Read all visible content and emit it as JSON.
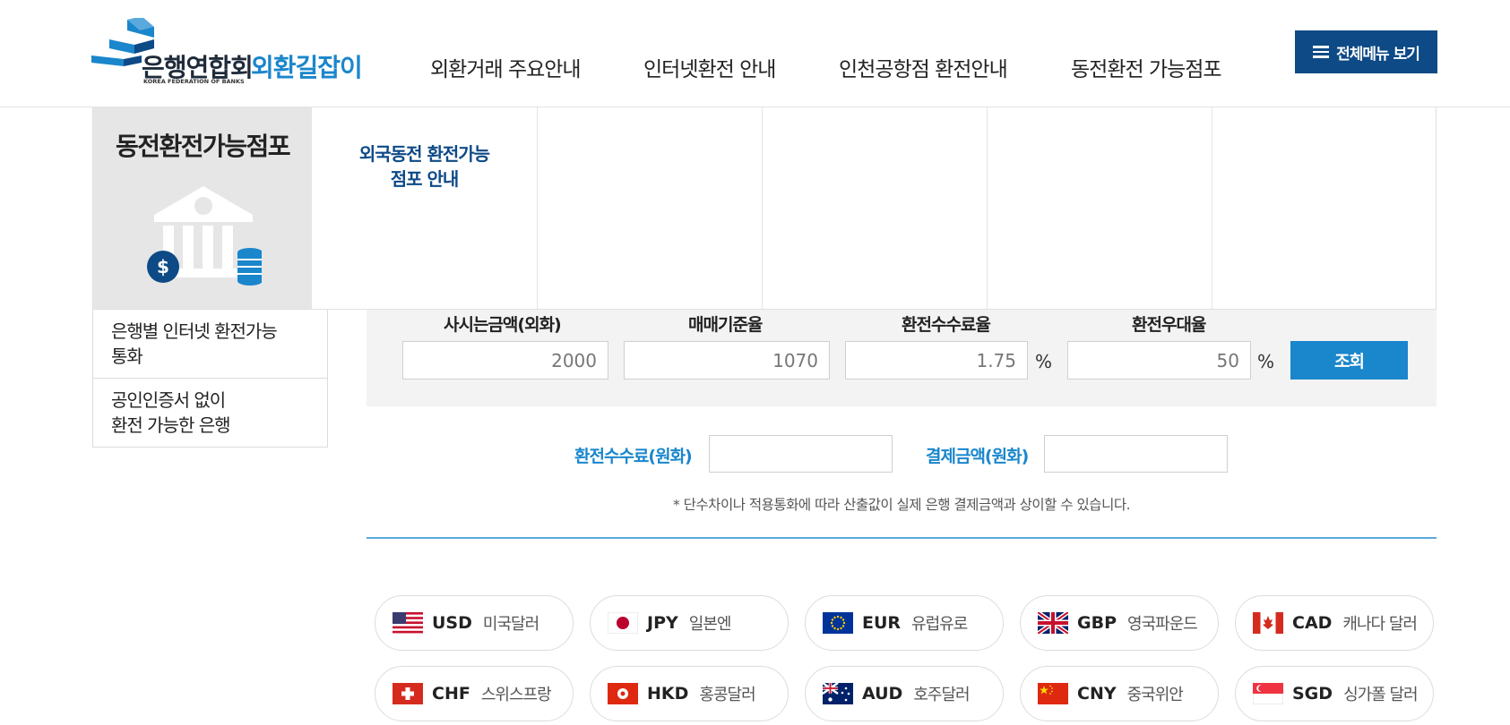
{
  "header": {
    "logo_text_1": "은행연합회",
    "logo_text_2": "외환길잡이",
    "logo_sub": "KOREA FEDERATION OF BANKS",
    "nav": [
      {
        "label": "외환거래 주요안내"
      },
      {
        "label": "인터넷환전 안내"
      },
      {
        "label": "인천공항점 환전안내"
      },
      {
        "label": "동전환전 가능점포"
      }
    ],
    "all_menu_label": "전체메뉴 보기"
  },
  "submenu": {
    "title": "동전환전가능점포",
    "links": [
      {
        "label_line1": "외국동전 환전가능",
        "label_line2": "점포 안내"
      }
    ]
  },
  "side_menu": {
    "items": [
      {
        "line1": "은행별 인터넷 환전가능",
        "line2": "통화"
      },
      {
        "line1": "공인인증서 없이",
        "line2": "환전 가능한 은행"
      }
    ]
  },
  "calculator": {
    "fields": [
      {
        "label": "사시는금액(외화)",
        "value": "2000"
      },
      {
        "label": "매매기준율",
        "value": "1070"
      },
      {
        "label": "환전수수료율",
        "value": "1.75",
        "unit": "%"
      },
      {
        "label": "환전우대율",
        "value": "50",
        "unit": "%"
      }
    ],
    "submit_label": "조회",
    "results": [
      {
        "label": "환전수수료(원화)",
        "value": ""
      },
      {
        "label": "결제금액(원화)",
        "value": ""
      }
    ],
    "note": "* 단수차이나 적용통화에 따라 산출값이 실제 은행 결제금액과 상이할 수 있습니다."
  },
  "currencies": [
    {
      "code": "USD",
      "name": "미국달러",
      "flag": "us-flag-icon"
    },
    {
      "code": "JPY",
      "name": "일본엔",
      "flag": "jp-flag-icon"
    },
    {
      "code": "EUR",
      "name": "유럽유로",
      "flag": "eu-flag-icon"
    },
    {
      "code": "GBP",
      "name": "영국파운드",
      "flag": "gb-flag-icon"
    },
    {
      "code": "CAD",
      "name": "캐나다 달러",
      "flag": "ca-flag-icon"
    },
    {
      "code": "CHF",
      "name": "스위스프랑",
      "flag": "ch-flag-icon"
    },
    {
      "code": "HKD",
      "name": "홍콩달러",
      "flag": "hk-flag-icon"
    },
    {
      "code": "AUD",
      "name": "호주달러",
      "flag": "au-flag-icon"
    },
    {
      "code": "CNY",
      "name": "중국위안",
      "flag": "cn-flag-icon"
    },
    {
      "code": "SGD",
      "name": "싱가폴 달러",
      "flag": "sg-flag-icon"
    }
  ],
  "colors": {
    "primary_navy": "#0d4a86",
    "accent_blue": "#1a86cc"
  }
}
